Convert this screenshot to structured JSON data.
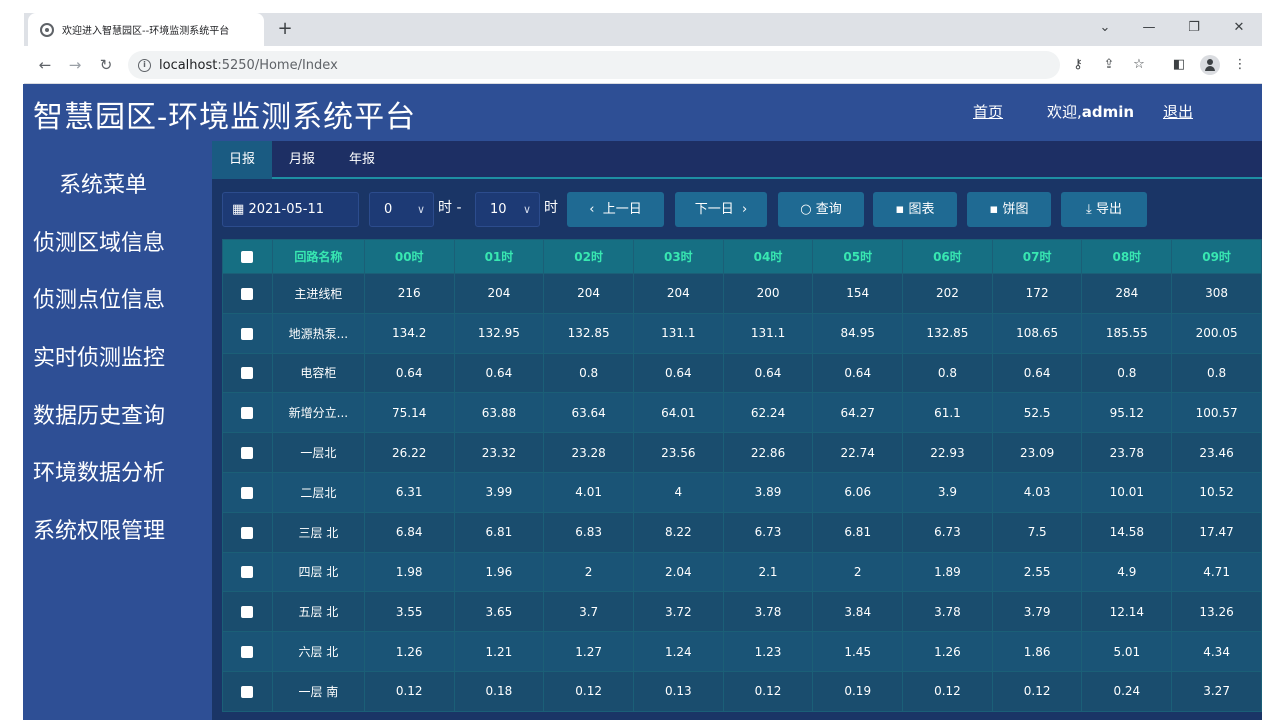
{
  "browser": {
    "tab_title": "欢迎进入智慧园区--环境监测系统平台",
    "new_tab": "+",
    "url_host": "localhost",
    "url_path": ":5250/Home/Index"
  },
  "header": {
    "title": "智慧园区-环境监测系统平台",
    "home_link": "首页",
    "welcome_prefix": "欢迎,",
    "username": "admin",
    "logout_link": "退出"
  },
  "sidebar": {
    "title": "系统菜单",
    "items": [
      "侦测区域信息",
      "侦测点位信息",
      "实时侦测监控",
      "数据历史查询",
      "环境数据分析",
      "系统权限管理"
    ]
  },
  "report_tabs": [
    "日报",
    "月报",
    "年报"
  ],
  "filters": {
    "date": "2021-05-11",
    "hour_start": "0",
    "hour_label": "时",
    "dash": "-",
    "hour_end": "10",
    "hour_end_label": "时",
    "prev_day": "上一日",
    "next_day": "下一日",
    "query": "查询",
    "chart": "图表",
    "pie": "饼图",
    "export": "导出"
  },
  "table": {
    "columns": [
      "回路名称",
      "00时",
      "01时",
      "02时",
      "03时",
      "04时",
      "05时",
      "06时",
      "07时",
      "08时",
      "09时"
    ],
    "rows": [
      [
        "主进线柜",
        "216",
        "204",
        "204",
        "204",
        "200",
        "154",
        "202",
        "172",
        "284",
        "308"
      ],
      [
        "地源热泵...",
        "134.2",
        "132.95",
        "132.85",
        "131.1",
        "131.1",
        "84.95",
        "132.85",
        "108.65",
        "185.55",
        "200.05"
      ],
      [
        "电容柜",
        "0.64",
        "0.64",
        "0.8",
        "0.64",
        "0.64",
        "0.64",
        "0.8",
        "0.64",
        "0.8",
        "0.8"
      ],
      [
        "新增分立...",
        "75.14",
        "63.88",
        "63.64",
        "64.01",
        "62.24",
        "64.27",
        "61.1",
        "52.5",
        "95.12",
        "100.57"
      ],
      [
        "一层北",
        "26.22",
        "23.32",
        "23.28",
        "23.56",
        "22.86",
        "22.74",
        "22.93",
        "23.09",
        "23.78",
        "23.46"
      ],
      [
        "二层北",
        "6.31",
        "3.99",
        "4.01",
        "4",
        "3.89",
        "6.06",
        "3.9",
        "4.03",
        "10.01",
        "10.52"
      ],
      [
        "三层 北",
        "6.84",
        "6.81",
        "6.83",
        "8.22",
        "6.73",
        "6.81",
        "6.73",
        "7.5",
        "14.58",
        "17.47"
      ],
      [
        "四层 北",
        "1.98",
        "1.96",
        "2",
        "2.04",
        "2.1",
        "2",
        "1.89",
        "2.55",
        "4.9",
        "4.71"
      ],
      [
        "五层 北",
        "3.55",
        "3.65",
        "3.7",
        "3.72",
        "3.78",
        "3.84",
        "3.78",
        "3.79",
        "12.14",
        "13.26"
      ],
      [
        "六层 北",
        "1.26",
        "1.21",
        "1.27",
        "1.24",
        "1.23",
        "1.45",
        "1.26",
        "1.86",
        "5.01",
        "4.34"
      ],
      [
        "一层 南",
        "0.12",
        "0.18",
        "0.12",
        "0.13",
        "0.12",
        "0.19",
        "0.12",
        "0.12",
        "0.24",
        "3.27"
      ]
    ]
  }
}
